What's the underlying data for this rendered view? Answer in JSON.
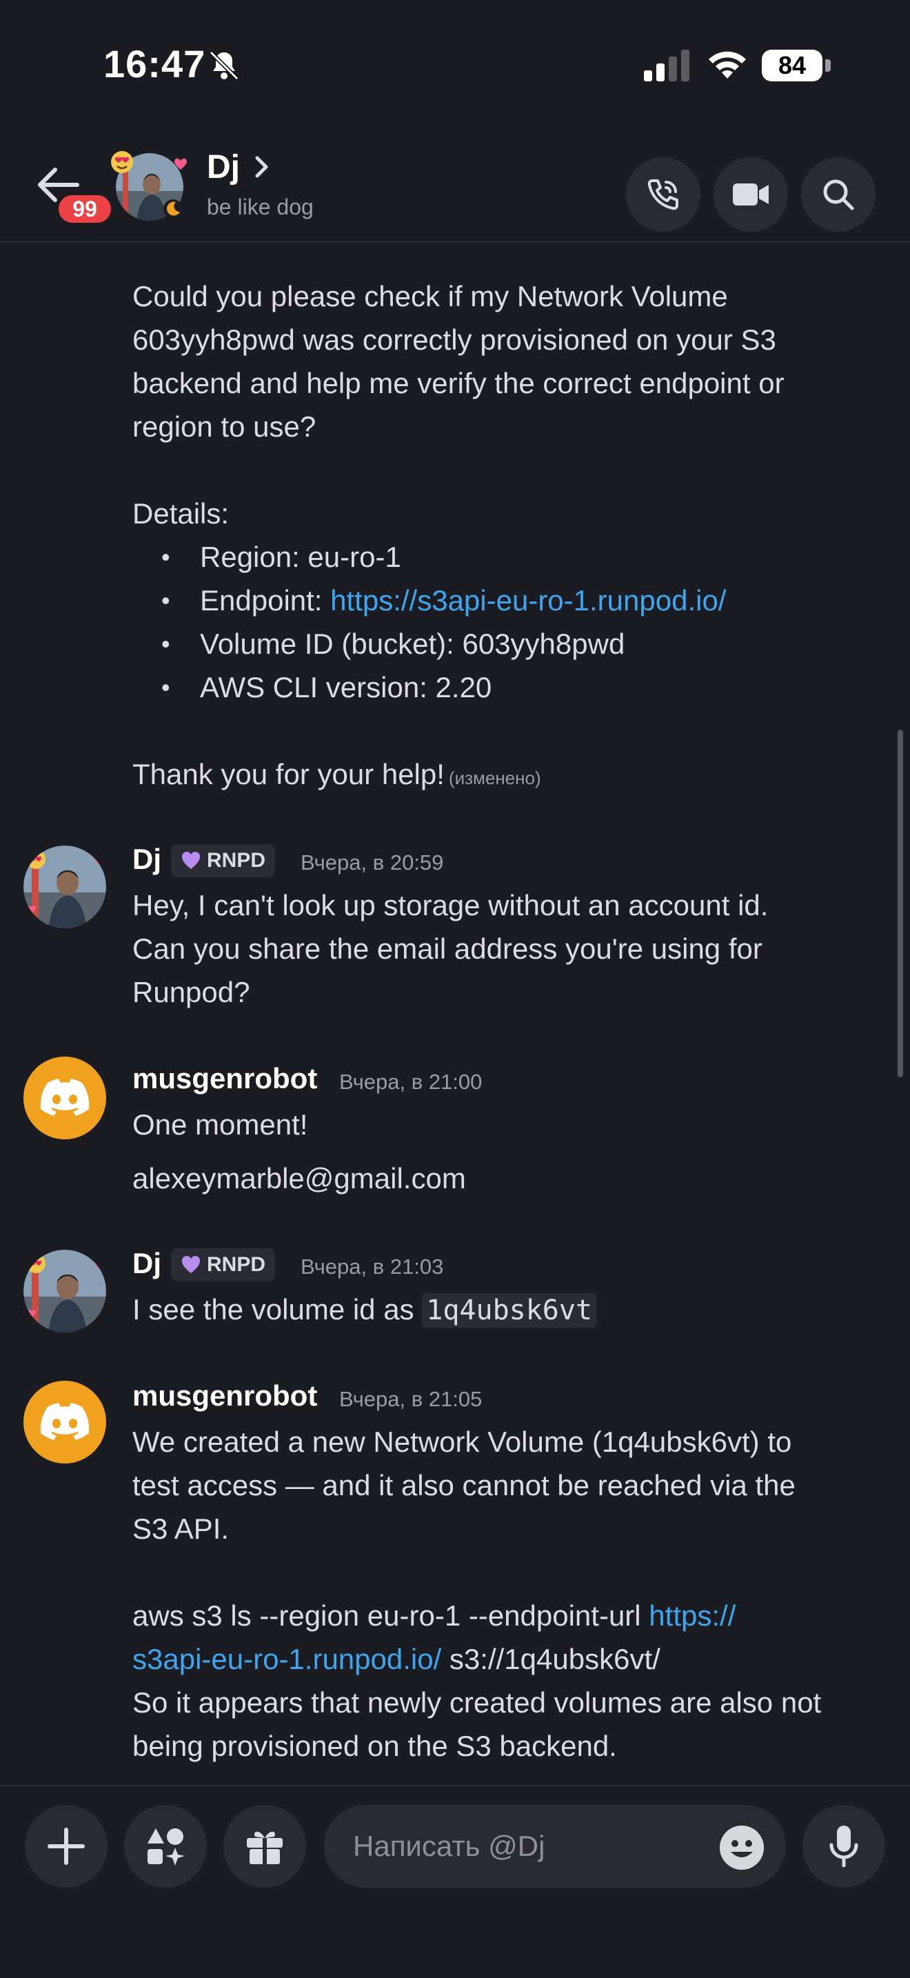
{
  "status_bar": {
    "time": "16:47",
    "battery": "84"
  },
  "header": {
    "name": "Dj",
    "status": "be like dog",
    "unread_count": "99"
  },
  "messages": [
    {
      "type": "continuation",
      "lines": [
        "Could you please check if my Network Volume",
        "603yyh8pwd was correctly provisioned on your S3",
        "backend and help me verify the correct endpoint or",
        "region to use?"
      ],
      "details_label": "Details:",
      "bullets": {
        "region": "Region: eu-ro-1",
        "endpoint_label": "Endpoint: ",
        "endpoint_link": "https://s3api-eu-ro-1.runpod.io/",
        "volume": "Volume ID (bucket): 603yyh8pwd",
        "cli": "AWS CLI version: 2.20"
      },
      "thanks": "Thank you for your help!",
      "edited": "(изменено)"
    },
    {
      "author": "Dj",
      "role": "RNPD",
      "time": "Вчера, в 20:59",
      "lines": [
        "Hey, I can't look up storage without an account id.",
        "Can you share the email address you're using for",
        "Runpod?"
      ]
    },
    {
      "author": "musgenrobot",
      "time": "Вчера, в 21:00",
      "line1": "One moment!",
      "line2": "alexeymarble@gmail.com"
    },
    {
      "author": "Dj",
      "role": "RNPD",
      "time": "Вчера, в 21:03",
      "text": "I see the volume id as ",
      "code": "1q4ubsk6vt"
    },
    {
      "author": "musgenrobot",
      "time": "Вчера, в 21:05",
      "lines": [
        "We created a new Network Volume (1q4ubsk6vt) to",
        "test access — and it also cannot be reached via the",
        "S3 API."
      ],
      "cmd_prefix": "aws s3 ls --region eu-ro-1 --endpoint-url ",
      "cmd_link1": "https://",
      "cmd_link2": "s3api-eu-ro-1.runpod.io/",
      "cmd_suffix": " s3://1q4ubsk6vt/",
      "tail": [
        "So it appears that newly created volumes are also not",
        "being provisioned on the S3 backend."
      ]
    }
  ],
  "composer": {
    "placeholder": "Написать @Dj"
  },
  "colors": {
    "background": "#1b1c21",
    "link": "#3ea6f0",
    "bot_avatar": "#f0a21e",
    "badge": "#ed4245",
    "role_heart": "#b98cf0"
  },
  "icons": [
    "back-arrow-icon",
    "phone-icon",
    "video-camera-icon",
    "search-icon",
    "plus-icon",
    "apps-icon",
    "gift-icon",
    "emoji-icon",
    "microphone-icon",
    "bell-slash-icon",
    "discord-icon",
    "heart-icon"
  ]
}
